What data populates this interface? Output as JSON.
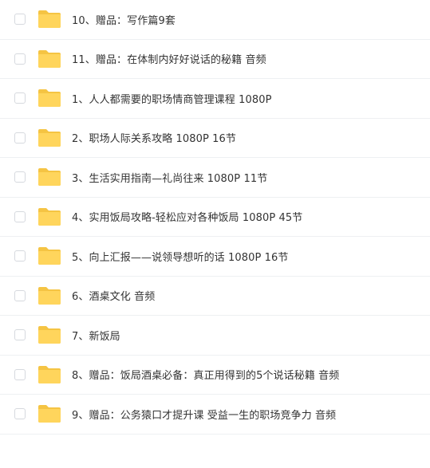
{
  "colors": {
    "folder_body": "#ffd55c",
    "folder_tab": "#f5c443",
    "text": "#333333",
    "divider": "#eef0f2"
  },
  "files": [
    {
      "name": "10、赠品：写作篇9套",
      "icon": "folder-icon"
    },
    {
      "name": "11、赠品：在体制内好好说话的秘籍 音频",
      "icon": "folder-icon"
    },
    {
      "name": "1、人人都需要的职场情商管理课程 1080P",
      "icon": "folder-icon"
    },
    {
      "name": "2、职场人际关系攻略 1080P 16节",
      "icon": "folder-icon"
    },
    {
      "name": "3、生活实用指南—礼尚往来 1080P 11节",
      "icon": "folder-icon"
    },
    {
      "name": "4、实用饭局攻略-轻松应对各种饭局 1080P 45节",
      "icon": "folder-icon"
    },
    {
      "name": "5、向上汇报——说领导想听的话 1080P 16节",
      "icon": "folder-icon"
    },
    {
      "name": "6、酒桌文化 音频",
      "icon": "folder-icon"
    },
    {
      "name": "7、新饭局",
      "icon": "folder-icon"
    },
    {
      "name": "8、赠品：饭局酒桌必备：真正用得到的5个说话秘籍 音频",
      "icon": "folder-icon"
    },
    {
      "name": "9、赠品：公务猿口才提升课 受益一生的职场竞争力 音频",
      "icon": "folder-icon"
    }
  ]
}
